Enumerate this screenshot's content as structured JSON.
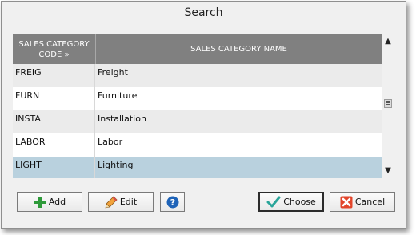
{
  "dialog": {
    "title": "Search"
  },
  "grid": {
    "columns": [
      "SALES CATEGORY CODE »",
      "SALES CATEGORY NAME"
    ],
    "rows": [
      {
        "code": "FREIG",
        "name": "Freight"
      },
      {
        "code": "FURN",
        "name": "Furniture"
      },
      {
        "code": "INSTA",
        "name": "Installation"
      },
      {
        "code": "LABOR",
        "name": "Labor"
      },
      {
        "code": "LIGHT",
        "name": "Lighting"
      }
    ],
    "selected_row": "LIGHT"
  },
  "buttons": {
    "add": "Add",
    "edit": "Edit",
    "choose": "Choose",
    "cancel": "Cancel"
  },
  "icons": {
    "add": "plus-icon",
    "edit": "pencil-icon",
    "help": "help-icon",
    "choose": "checkmark-icon",
    "cancel": "x-icon"
  },
  "colors": {
    "header_bg": "#808080",
    "selected_row": "#b9d1de",
    "alt_row": "#ebebeb",
    "add_green": "#2e9a3a",
    "cancel_red": "#e2452b",
    "check_teal": "#2aa59a",
    "help_blue": "#1e63b8"
  }
}
